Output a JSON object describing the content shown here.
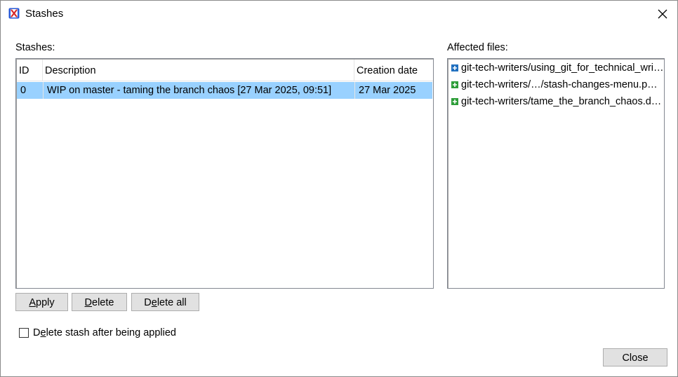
{
  "window": {
    "title": "Stashes"
  },
  "stashes": {
    "label": "Stashes:",
    "columns": {
      "id": "ID",
      "description": "Description",
      "creation_date": "Creation date"
    },
    "rows": [
      {
        "id": "0",
        "description": "WIP on master - taming the branch chaos [27 Mar 2025, 09:51]",
        "creation_date": "27 Mar 2025"
      }
    ]
  },
  "affected_files": {
    "label": "Affected files:",
    "items": [
      {
        "text": "git-tech-writers/using_git_for_technical_wri…",
        "status": "modified",
        "icon": "modified-file-icon"
      },
      {
        "text": "git-tech-writers/…/stash-changes-menu.p…",
        "status": "added",
        "icon": "added-file-icon"
      },
      {
        "text": "git-tech-writers/tame_the_branch_chaos.d…",
        "status": "added",
        "icon": "added-file-icon"
      }
    ]
  },
  "buttons": {
    "apply": {
      "mnemonic": "A",
      "rest": "pply"
    },
    "delete": {
      "mnemonic": "D",
      "rest": "elete"
    },
    "delete_all": {
      "pre": "D",
      "mnemonic": "e",
      "rest": "lete all"
    },
    "close": "Close"
  },
  "options": {
    "delete_after_apply": {
      "pre": "D",
      "mnemonic": "e",
      "rest": "lete stash after being applied",
      "checked": false
    }
  },
  "colors": {
    "selection": "#99d1ff",
    "added_icon": "#2e9e3a",
    "modified_icon": "#1f6fbf",
    "button_face": "#e1e1e1"
  }
}
